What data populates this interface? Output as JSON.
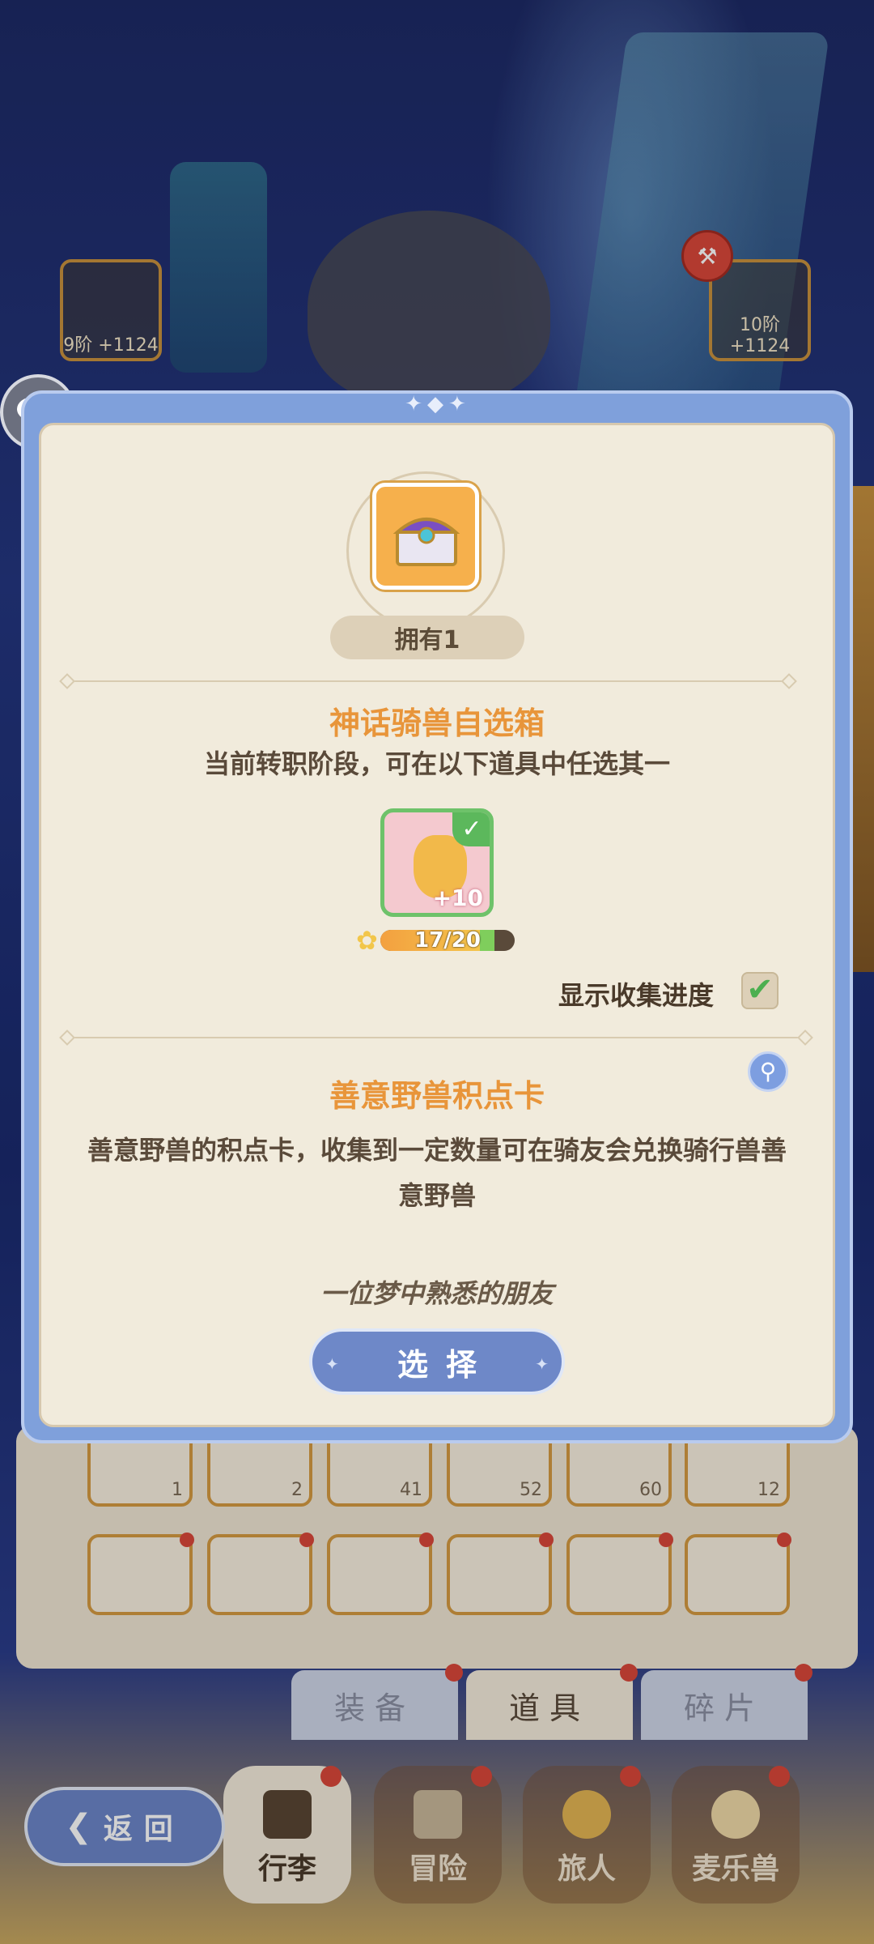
{
  "background": {
    "equip_left": {
      "level": "9阶 +1124"
    },
    "equip_right": {
      "level": "10阶 +1124"
    }
  },
  "popup": {
    "owned": "拥有1",
    "item_name": "神话骑兽自选箱",
    "instruction": "当前转职阶段，可在以下道具中任选其一",
    "reward": {
      "plus": "+10",
      "progress_text": "17/20",
      "progress": 0.85
    },
    "show_progress_label": "显示收集进度",
    "show_progress_checked": true,
    "detail_title": "善意野兽积点卡",
    "detail_desc": "善意野兽的积点卡，收集到一定数量可在骑友会兑换骑行兽善意野兽",
    "flavor": "一位梦中熟悉的朋友",
    "select_label": "选择"
  },
  "inventory": {
    "row1_counts": [
      "1",
      "2",
      "41",
      "52",
      "60",
      "12"
    ]
  },
  "tabs": [
    "装备",
    "道具",
    "碎片"
  ],
  "active_tab": "道具",
  "nav": {
    "back": "返回",
    "items": [
      "行李",
      "冒险",
      "旅人",
      "麦乐兽"
    ]
  },
  "colors": {
    "accent_orange": "#e8953a",
    "frame_blue": "#7fa0db",
    "check_green": "#5cb85c"
  }
}
